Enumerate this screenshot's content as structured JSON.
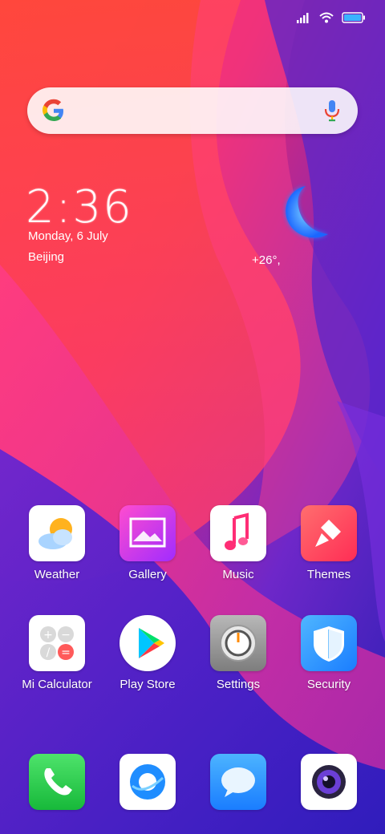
{
  "status": {
    "battery_color": "#3bb3ff"
  },
  "search": {
    "placeholder": ""
  },
  "clock": {
    "time": "2:36",
    "date": "Monday, 6 July",
    "city": "Beijing",
    "temperature": "+26°,"
  },
  "apps_row1": [
    {
      "label": "Weather",
      "icon": "weather-icon"
    },
    {
      "label": "Gallery",
      "icon": "gallery-icon"
    },
    {
      "label": "Music",
      "icon": "music-icon"
    },
    {
      "label": "Themes",
      "icon": "themes-icon"
    }
  ],
  "apps_row2": [
    {
      "label": "Mi Calculator",
      "icon": "calculator-icon"
    },
    {
      "label": "Play Store",
      "icon": "play-store-icon"
    },
    {
      "label": "Settings",
      "icon": "settings-icon"
    },
    {
      "label": "Security",
      "icon": "security-icon"
    }
  ],
  "dock": [
    {
      "icon": "phone-icon"
    },
    {
      "icon": "browser-icon"
    },
    {
      "icon": "messages-icon"
    },
    {
      "icon": "camera-icon"
    }
  ]
}
